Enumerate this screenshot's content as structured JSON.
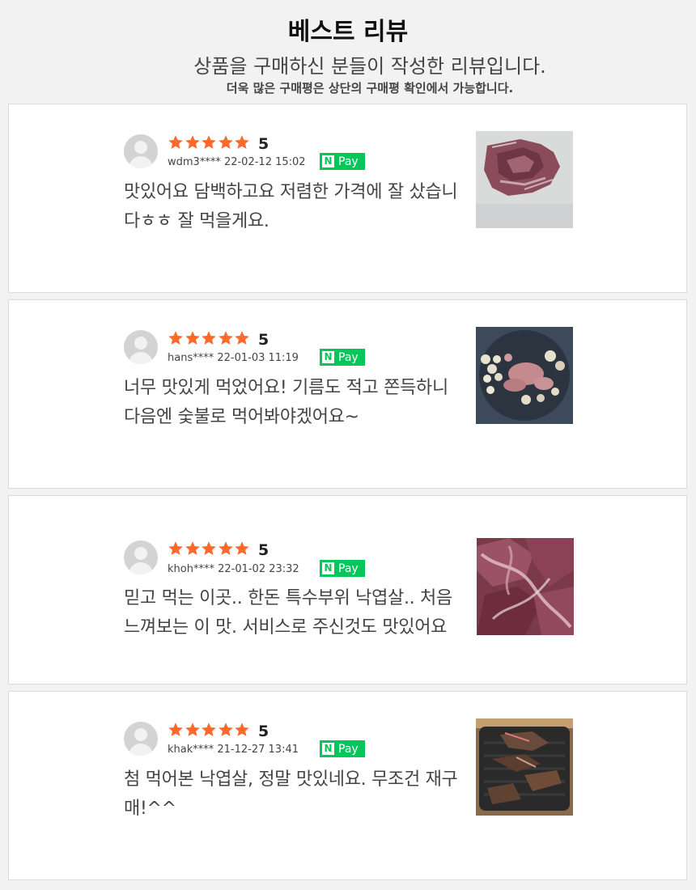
{
  "header": {
    "title": "베스트 리뷰",
    "subtitle": "상품을 구매하신 분들이 작성한 리뷰입니다.",
    "note": "더욱 많은 구매평은 상단의 구매평 확인에서 가능합니다."
  },
  "colors": {
    "star": "#ff6a2c",
    "npay": "#03c75a",
    "background": "#f2f2f2"
  },
  "reviews": [
    {
      "score": "5",
      "stars": 5,
      "meta": "wdm3**** 22-02-12 15:02",
      "badge": "Pay",
      "text": "맛있어요 담백하고요 저렴한 가격에 잘 샀습니다ㅎㅎ 잘 먹을게요.",
      "photo": "raw-meat-package-photo"
    },
    {
      "score": "5",
      "stars": 5,
      "meta": "hans**** 22-01-03 11:19",
      "badge": "Pay",
      "text": "너무 맛있게 먹었어요! 기름도 적고 쫀득하니 다음엔 숯불로 먹어봐야겠어요~",
      "photo": "grill-with-garlic-mushrooms-photo"
    },
    {
      "score": "5",
      "stars": 5,
      "meta": "khoh**** 22-01-02 23:32",
      "badge": "Pay",
      "text": "믿고 먹는 이곳.. 한돈 특수부위 낙엽살.. 처음 느껴보는 이 맛. 서비스로 주신것도 맛있어요",
      "photo": "raw-meat-closeup-photo"
    },
    {
      "score": "5",
      "stars": 5,
      "meta": "khak**** 21-12-27 13:41",
      "badge": "Pay",
      "text": "첨 먹어본 낙엽살, 정말 맛있네요. 무조건 재구매!^^",
      "photo": "grilled-meat-on-pan-photo"
    }
  ]
}
